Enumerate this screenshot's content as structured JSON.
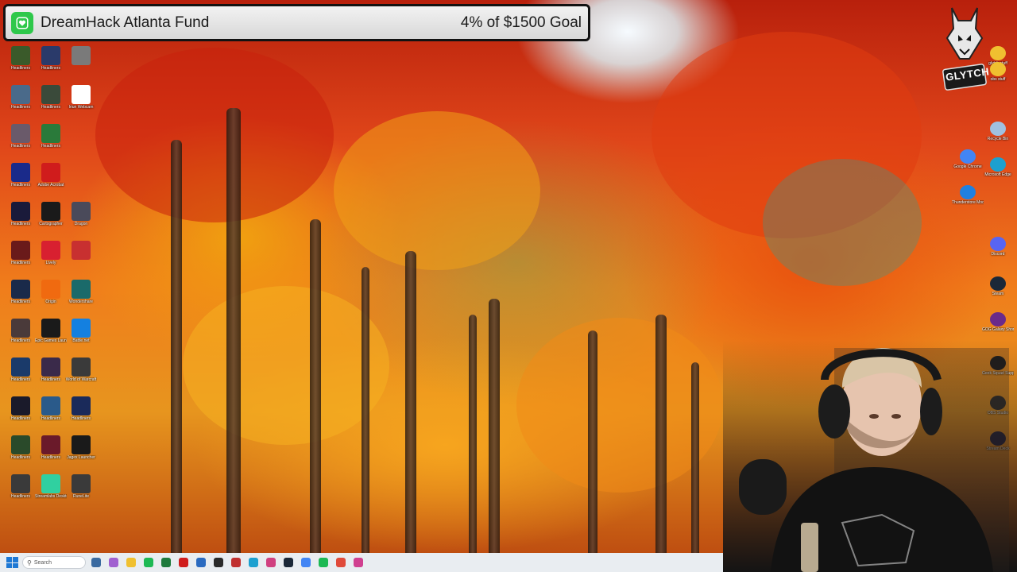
{
  "goal": {
    "title": "DreamHack Atlanta Fund",
    "status": "4% of $1500 Goal",
    "icon": "heart-icon",
    "accent_color": "#2ec84a"
  },
  "desktop_left": [
    {
      "label": "Headliners",
      "color": "#3a5a2a"
    },
    {
      "label": "Headliners",
      "color": "#2a3a6a"
    },
    {
      "label": "",
      "color": "#7a7a7a"
    },
    {
      "label": "Headliners",
      "color": "#4a6a8a"
    },
    {
      "label": "Headliners",
      "color": "#3a4a3a"
    },
    {
      "label": "Iriun Webcam",
      "color": "#ffffff"
    },
    {
      "label": "Headliners",
      "color": "#6a5a6a"
    },
    {
      "label": "Headliners",
      "color": "#2a7a3a"
    },
    {
      "label": "Headliners",
      "color": "#1a2a8a"
    },
    {
      "label": "Adobe Acrobat",
      "color": "#d01c1c"
    },
    {
      "label": "Headliners",
      "color": "#1a1a3a"
    },
    {
      "label": "Cartographer",
      "color": "#1a1a1a"
    },
    {
      "label": "Dragon",
      "color": "#4a4a5a"
    },
    {
      "label": "Headliners",
      "color": "#6a1a1a"
    },
    {
      "label": "Lively",
      "color": "#d82030"
    },
    {
      "label": "",
      "color": "#c83030"
    },
    {
      "label": "Headliners",
      "color": "#1a2a4a"
    },
    {
      "label": "Origin",
      "color": "#f06a10"
    },
    {
      "label": "Wondershare",
      "color": "#1a6a6a"
    },
    {
      "label": "Headliners",
      "color": "#4a3a3a"
    },
    {
      "label": "Epic Games Launcher",
      "color": "#1a1a1a"
    },
    {
      "label": "Battle.net",
      "color": "#1480e0"
    },
    {
      "label": "Headliners",
      "color": "#1a3a6a"
    },
    {
      "label": "Headliners",
      "color": "#3a2a4a"
    },
    {
      "label": "World of Warcraft",
      "color": "#3a3a3a"
    },
    {
      "label": "Headliners",
      "color": "#1a1a2a"
    },
    {
      "label": "Headliners",
      "color": "#2a5a8a"
    },
    {
      "label": "Headliners",
      "color": "#1a2a5a"
    },
    {
      "label": "Headliners",
      "color": "#2a4a2a"
    },
    {
      "label": "Headliners",
      "color": "#6a1a2a"
    },
    {
      "label": "Jagex Launcher",
      "color": "#1a1a1a"
    },
    {
      "label": "Headliners",
      "color": "#3a3a3a"
    },
    {
      "label": "Streamlabs Desktop",
      "color": "#30d0a0"
    },
    {
      "label": "RuneLite",
      "color": "#3a3a3a"
    }
  ],
  "desktop_right": [
    {
      "label": "glytch stuff",
      "color": "#f0c030"
    },
    {
      "label": "obs stuff",
      "color": "#f0c030"
    },
    {
      "label": "Recycle Bin",
      "color": "#a0c0e0"
    },
    {
      "label": "Google Chrome",
      "color": "#4285f4"
    },
    {
      "label": "Microsoft Edge",
      "color": "#1ca0d0"
    },
    {
      "label": "Thunderstore Mod Manager",
      "color": "#2080e0"
    },
    {
      "label": "Discord",
      "color": "#5865f2"
    },
    {
      "label": "Steam",
      "color": "#1b2838"
    },
    {
      "label": "GOG Galaxy Shortcut",
      "color": "#6a2a8a"
    },
    {
      "label": "Geek Squad Support.exe",
      "color": "#1a1a1a"
    },
    {
      "label": "OBS Studio",
      "color": "#2a2a2a"
    },
    {
      "label": "Stream Deck",
      "color": "#1a1a3a"
    }
  ],
  "logo": {
    "text": "GLYTCH",
    "icon": "wolf-logo-icon"
  },
  "taskbar": {
    "search_placeholder": "Search",
    "apps": [
      {
        "name": "widgets-icon",
        "color": "#3a6aa0"
      },
      {
        "name": "copilot-icon",
        "color": "#a060d0"
      },
      {
        "name": "file-explorer-icon",
        "color": "#f0c030"
      },
      {
        "name": "spotify-icon",
        "color": "#1db954"
      },
      {
        "name": "excel-icon",
        "color": "#1e7a3c"
      },
      {
        "name": "acrobat-icon",
        "color": "#d01c1c"
      },
      {
        "name": "calculator-icon",
        "color": "#2a6ac0"
      },
      {
        "name": "terminal-icon",
        "color": "#2a2a2a"
      },
      {
        "name": "music-icon",
        "color": "#c03030"
      },
      {
        "name": "edge-icon",
        "color": "#1ca0d0"
      },
      {
        "name": "snipping-icon",
        "color": "#d04080"
      },
      {
        "name": "steam-icon",
        "color": "#1b2838"
      },
      {
        "name": "chrome-icon",
        "color": "#4285f4"
      },
      {
        "name": "spotify-green-icon",
        "color": "#1db954"
      },
      {
        "name": "chrome-alt-icon",
        "color": "#e04a3a"
      },
      {
        "name": "streamlabs-icon",
        "color": "#d04090"
      }
    ]
  }
}
